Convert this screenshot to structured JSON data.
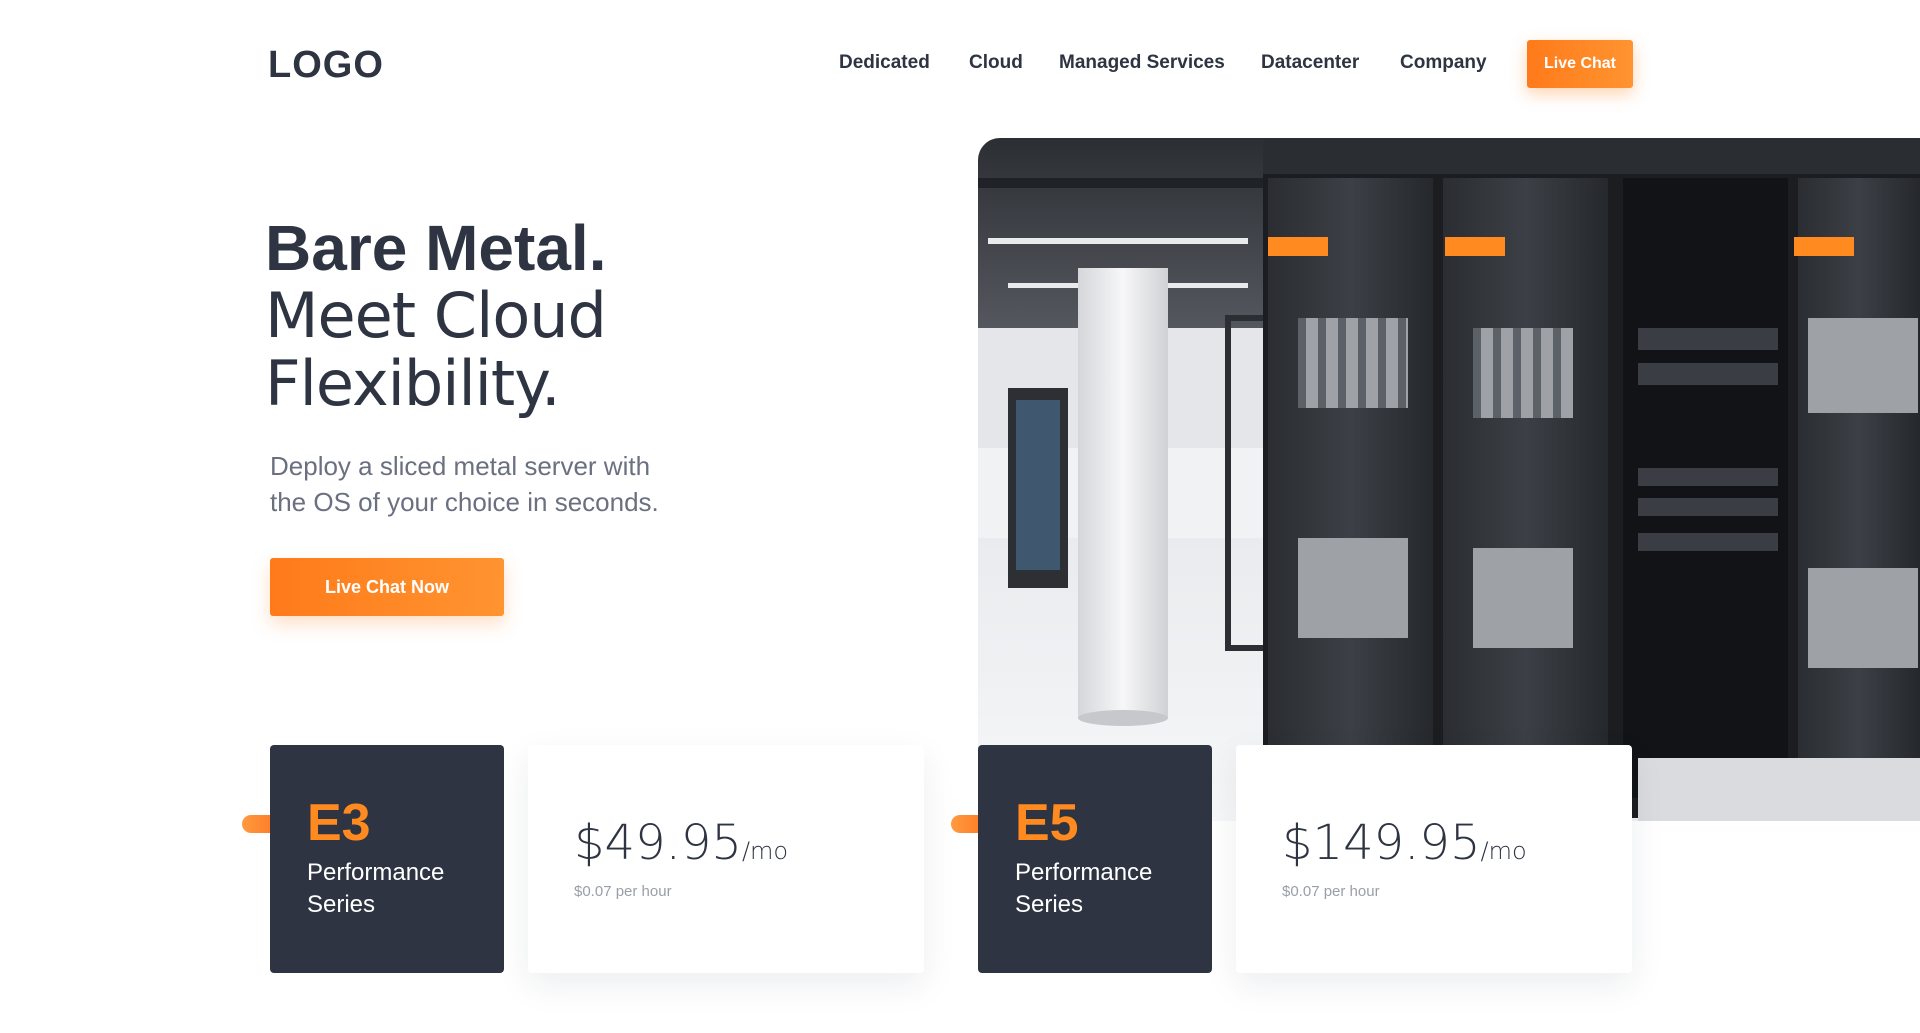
{
  "header": {
    "logo": "LOGO",
    "nav": [
      "Dedicated",
      "Cloud",
      "Managed Services",
      "Datacenter",
      "Company"
    ],
    "cta": "Live Chat"
  },
  "hero": {
    "title_bold": "Bare Metal.",
    "title_line2": "Meet Cloud",
    "title_line3": "Flexibility.",
    "subtitle_line1": "Deploy a sliced metal server with",
    "subtitle_line2": "the OS of your choice in seconds.",
    "cta": "Live Chat Now"
  },
  "plans": [
    {
      "code": "E3",
      "name_line1": "Performance",
      "name_line2": "Series",
      "price": "$49.95",
      "unit": "/mo",
      "hourly": "$0.07 per hour"
    },
    {
      "code": "E5",
      "name_line1": "Performance",
      "name_line2": "Series",
      "price": "$149.95",
      "unit": "/mo",
      "hourly": "$0.07 per hour"
    }
  ],
  "colors": {
    "accent": "#ff8a1f",
    "dark": "#2e3442",
    "muted": "#6b7080"
  }
}
